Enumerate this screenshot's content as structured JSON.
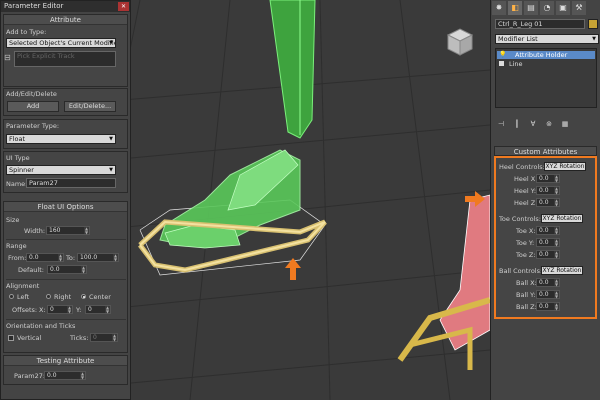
{
  "param_editor": {
    "title": "Parameter Editor",
    "attribute_header": "Attribute",
    "add_to_type_label": "Add to Type:",
    "add_to_type_value": "Selected Object's Current Modifier",
    "pick_label": "Pick Explicit Track",
    "add_edit_delete_label": "Add/Edit/Delete",
    "add_button": "Add",
    "edit_delete_button": "Edit/Delete...",
    "parameter_type_label": "Parameter Type:",
    "parameter_type_value": "Float",
    "ui_type_label": "UI Type",
    "ui_type_value": "Spinner",
    "name_label": "Name:",
    "name_value": "Param27",
    "float_ui_header": "Float UI Options",
    "size_label": "Size",
    "width_label": "Width:",
    "width_value": "160",
    "range_label": "Range",
    "from_label": "From:",
    "from_value": "0.0",
    "to_label": "To:",
    "to_value": "100.0",
    "default_label": "Default:",
    "default_value": "0.0",
    "alignment_label": "Alignment",
    "left_label": "Left",
    "right_label": "Right",
    "center_label": "Center",
    "offsets_label": "Offsets:",
    "offx_label": "X:",
    "offx_value": "0",
    "offy_label": "Y:",
    "offy_value": "0",
    "orientation_label": "Orientation and Ticks",
    "vertical_label": "Vertical",
    "ticks_label": "Ticks:",
    "ticks_value": "0",
    "testing_header": "Testing Attribute",
    "param27_label": "Param27:",
    "param27_value": "0.0"
  },
  "cmd_panel": {
    "tabs": [
      "create-icon",
      "modify-icon",
      "hierarchy-icon",
      "motion-icon",
      "display-icon",
      "utilities-icon"
    ],
    "object_name": "Ctrl_R_Leg 01",
    "swatch_color": "#c6a335",
    "modifier_list": "Modifier List",
    "stack_items": [
      "Attribute Holder",
      "Line"
    ],
    "custom_attributes_header": "Custom Attributes",
    "heel_controls_label": "Heel Controls:",
    "heel_controls_button": "XYZ Rotation",
    "heel_x_label": "Heel X:",
    "heel_x_value": "0.0",
    "heel_y_label": "Heel Y:",
    "heel_y_value": "0.0",
    "heel_z_label": "Heel Z:",
    "heel_z_value": "0.0",
    "toe_controls_label": "Toe Controls:",
    "toe_controls_button": "XYZ Rotation",
    "toe_x_label": "Toe X:",
    "toe_x_value": "0.0",
    "toe_y_label": "Toe Y:",
    "toe_y_value": "0.0",
    "toe_z_label": "Toe Z:",
    "toe_z_value": "0.0",
    "ball_controls_label": "Ball Controls:",
    "ball_controls_button": "XYZ Rotation",
    "ball_x_label": "Ball X:",
    "ball_x_value": "0.0",
    "ball_y_label": "Ball Y:",
    "ball_y_value": "0.0",
    "ball_z_label": "Ball Z:",
    "ball_z_value": "0.0"
  },
  "colors": {
    "highlight_orange": "#f07a20",
    "leg_green": "#4fc24f",
    "control_yellow": "#d8b84a",
    "leg_pink": "#e07a80"
  }
}
